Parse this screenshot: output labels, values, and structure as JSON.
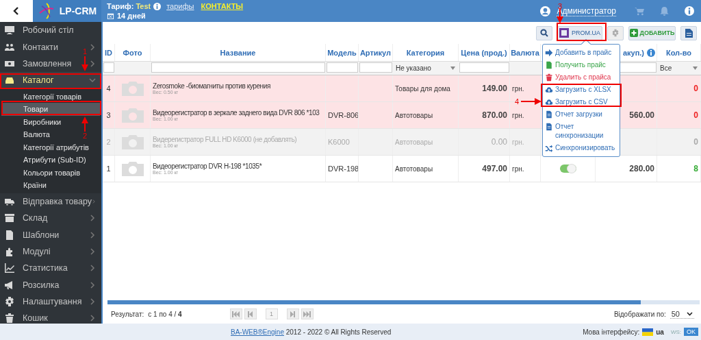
{
  "header": {
    "logo": "LP-CRM",
    "tariff_label": "Тариф:",
    "tariff": "Test",
    "tariffs_link": "тарифы",
    "contacts_link": "КОНТАКТЫ",
    "days": "14 дней",
    "user": "Администратор"
  },
  "sidebar": {
    "items": [
      {
        "label": "Робочий стіл",
        "selected": false
      },
      {
        "label": "Контакти",
        "selected": false,
        "expanded": false
      },
      {
        "label": "Замовлення",
        "selected": false,
        "expanded": false
      },
      {
        "label": "Каталог",
        "selected": true,
        "expanded": true,
        "children": [
          {
            "label": "Категорії товарів",
            "selected": false
          },
          {
            "label": "Товари",
            "selected": true
          },
          {
            "label": "Виробники",
            "selected": false
          },
          {
            "label": "Валюта",
            "selected": false
          },
          {
            "label": "Категорії атрибутів",
            "selected": false
          },
          {
            "label": "Атрибути (Sub-ID)",
            "selected": false
          },
          {
            "label": "Кольори товарів",
            "selected": false
          },
          {
            "label": "Країни",
            "selected": false
          }
        ]
      },
      {
        "label": "Відправка товару",
        "selected": false,
        "expanded": false
      },
      {
        "label": "Склад",
        "selected": false,
        "expanded": false
      },
      {
        "label": "Шаблони",
        "selected": false,
        "expanded": false
      },
      {
        "label": "Модулі",
        "selected": false,
        "expanded": false
      },
      {
        "label": "Статистика",
        "selected": false,
        "expanded": false
      },
      {
        "label": "Розсилка",
        "selected": false,
        "expanded": false
      },
      {
        "label": "Налаштування",
        "selected": false,
        "expanded": false
      },
      {
        "label": "Кошик",
        "selected": false,
        "expanded": false
      }
    ]
  },
  "toolbar": {
    "prom_button": "PROM.UA",
    "add_button": "ДОБАВИТЬ"
  },
  "prom_menu": [
    {
      "label": "Добавить в прайс",
      "color": "#2f6db5"
    },
    {
      "label": "Получить прайс",
      "color": "#3aa54a"
    },
    {
      "label": "Удалить с прайса",
      "color": "#e0334a"
    },
    {
      "label": "Загрузить с XLSX",
      "color": "#2f6db5"
    },
    {
      "label": "Загрузить с CSV",
      "color": "#2f6db5"
    },
    {
      "label": "Отчет загрузки",
      "color": "#2f6db5"
    },
    {
      "label": "Отчет синхронизации",
      "color": "#2f6db5"
    },
    {
      "label": "Синхронизировать",
      "color": "#2f6db5"
    }
  ],
  "table": {
    "columns": [
      "ID",
      "Фото",
      "Название",
      "Модель",
      "Артикул",
      "Категория",
      "Цена (прод.)",
      "Валюта",
      "",
      "акуп.)",
      "Кол-во"
    ],
    "filters": {
      "category": "Не указано",
      "quantity": "Все"
    },
    "rows": [
      {
        "id": "4",
        "name": "Zerosmoke -биомагниты против курения",
        "weight": "Вес: 0.50 кг",
        "model": "",
        "category": "Товары для дома",
        "price": "149.00",
        "currency": "грн.",
        "purchase": "",
        "quantity": "0",
        "color": "#ee2222",
        "highlighted": true,
        "disabled": false
      },
      {
        "id": "3",
        "name": "Видеорегистратор в зеркале заднего вида DVR 806 *103",
        "weight": "Вес: 1.00 кг",
        "model": "DVR-806",
        "category": "Автотовары",
        "price": "870.00",
        "currency": "грн.",
        "purchase": "560.00",
        "quantity": "0",
        "color": "#ee2222",
        "highlighted": true,
        "disabled": false
      },
      {
        "id": "2",
        "name": "Видерегистратор FULL HD K6000 (не добавлять)",
        "weight": "Вес: 1.00 кг",
        "model": "K6000",
        "category": "Автотовары",
        "price": "0.00",
        "currency": "грн.",
        "purchase": "",
        "quantity": "0",
        "color": "#aaaaaa",
        "highlighted": false,
        "disabled": true
      },
      {
        "id": "1",
        "name": "Видеорегистратор DVR H-198 *1035*",
        "weight": "Вес: 1.00 кг",
        "model": "DVR-198",
        "category": "Автотовары",
        "price": "497.00",
        "currency": "грн.",
        "purchase": "280.00",
        "quantity": "8",
        "color": "#33aa33",
        "highlighted": false,
        "disabled": false,
        "sync": {
          "on": true
        }
      }
    ]
  },
  "pagination": {
    "result_label": "Результат:",
    "result": "с 1 по 4 / **4**",
    "page": "1",
    "per_page_label": "Відображати по:",
    "per_page": "50"
  },
  "footer": {
    "engine_link": "BA-WEB®Engine",
    "copyright": "2012 - 2022 © All Rights Reserved",
    "language_label": "Мова інтерфейсу:",
    "language": "ua",
    "ws_label": "WS:",
    "ws_status": "OK"
  },
  "annotations": [
    {
      "label": "1"
    },
    {
      "label": "2"
    },
    {
      "label": "3"
    },
    {
      "label": "4"
    }
  ]
}
